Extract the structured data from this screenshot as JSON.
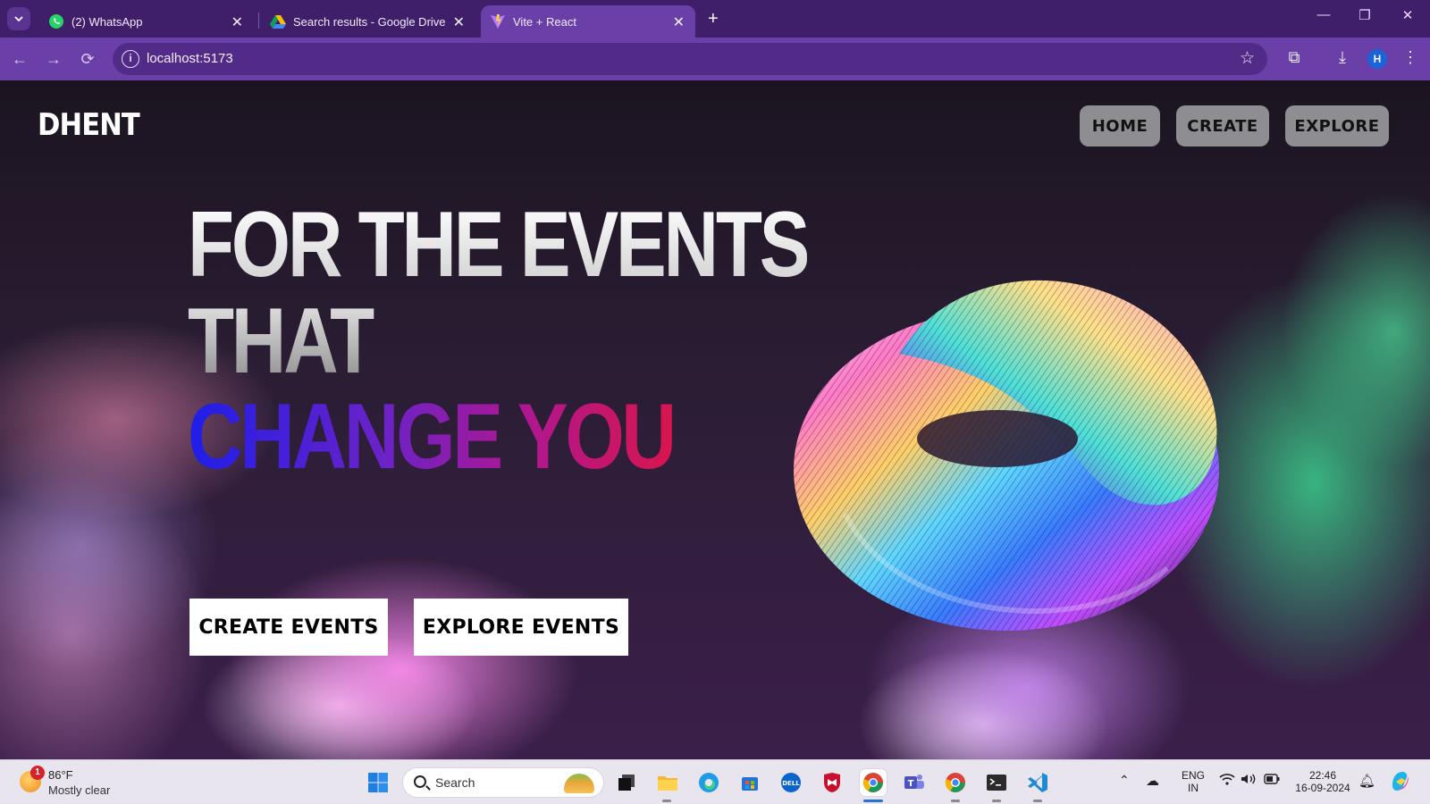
{
  "browser": {
    "tabs": [
      {
        "title": "(2) WhatsApp",
        "icon": "whatsapp-icon",
        "active": false
      },
      {
        "title": "Search results - Google Drive",
        "icon": "google-drive-icon",
        "active": false
      },
      {
        "title": "Vite + React",
        "icon": "vite-icon",
        "active": true
      }
    ],
    "url": "localhost:5173",
    "profile_initial": "H",
    "accent": "#6a40a8"
  },
  "site": {
    "logo": "DHENT",
    "nav": [
      {
        "label": "HOME"
      },
      {
        "label": "CREATE"
      },
      {
        "label": "EXPLORE"
      }
    ],
    "hero": {
      "line1": "FOR THE EVENTS",
      "line2": "THAT",
      "line3": "CHANGE YOU"
    },
    "buttons": {
      "create": "CREATE EVENTS",
      "explore": "EXPLORE EVENTS"
    }
  },
  "taskbar": {
    "weather": {
      "badge": "1",
      "temp": "86°F",
      "condition": "Mostly clear"
    },
    "search_label": "Search",
    "language": {
      "line1": "ENG",
      "line2": "IN"
    },
    "clock": {
      "time": "22:46",
      "date": "16-09-2024"
    }
  }
}
